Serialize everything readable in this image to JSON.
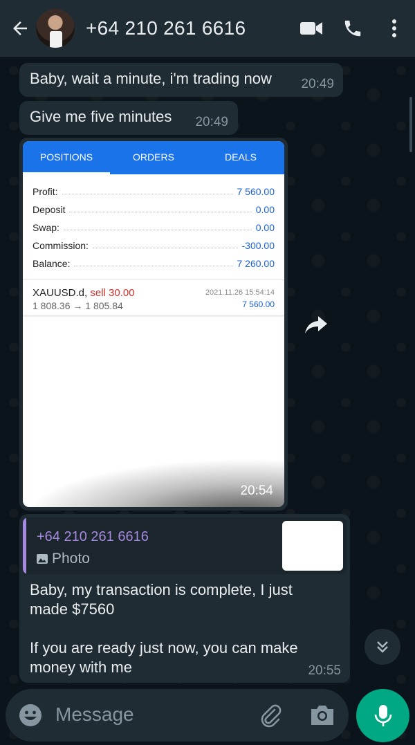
{
  "header": {
    "title": "+64 210 261 6616",
    "back_icon": "arrow-left-icon",
    "video_icon": "videocam-icon",
    "call_icon": "phone-icon",
    "menu_icon": "more-vertical-icon"
  },
  "messages": [
    {
      "text": "Baby, wait a minute, i'm trading now",
      "time": "20:49"
    },
    {
      "text": "Give me five minutes",
      "time": "20:49"
    }
  ],
  "image_message": {
    "time": "20:54",
    "screenshot": {
      "tabs": [
        "POSITIONS",
        "ORDERS",
        "DEALS"
      ],
      "active_tab": "POSITIONS",
      "summary": [
        {
          "label": "Profit:",
          "value": "7 560.00"
        },
        {
          "label": "Deposit",
          "value": "0.00"
        },
        {
          "label": "Swap:",
          "value": "0.00"
        },
        {
          "label": "Commission:",
          "value": "-300.00"
        },
        {
          "label": "Balance:",
          "value": "7 260.00"
        }
      ],
      "trade": {
        "symbol": "XAUUSD.d,",
        "side": "sell 30.00",
        "prices": "1 808.36 → 1 805.84",
        "datetime": "2021.11.26 15:54:14",
        "profit": "7 560.00"
      }
    }
  },
  "reply_message": {
    "quoted_name": "+64 210 261 6616",
    "quoted_type": "Photo",
    "text": "Baby, my transaction is complete, I just made $7560\n\nIf you are ready just now, you can make money with me",
    "time": "20:55"
  },
  "composer": {
    "placeholder": "Message"
  },
  "colors": {
    "accent": "#00a884",
    "header_bg": "#1f2c34",
    "bubble_bg": "#202c33",
    "quote_name": "#a68ae0"
  }
}
